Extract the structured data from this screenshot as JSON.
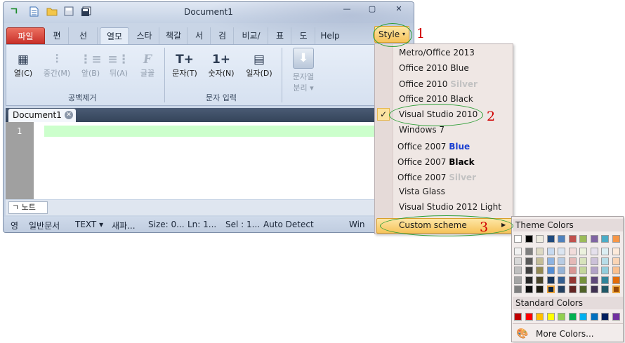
{
  "window": {
    "title": "Document1",
    "quick_access": [
      "ㄱ",
      "new-doc-icon",
      "open-folder-icon",
      "save-icon",
      "save-all-icon"
    ],
    "controls": [
      "—",
      "▢",
      "✕"
    ]
  },
  "tabs": [
    "파일",
    "편",
    "선",
    "열모",
    "스타",
    "책갈",
    "서",
    "검",
    "비교/",
    "표",
    "도",
    "Help"
  ],
  "ribbon": {
    "buttons": [
      {
        "label": "열(C)",
        "icon": "▦",
        "disabled": false
      },
      {
        "label": "중간(M)",
        "icon": "⫶",
        "disabled": true
      },
      {
        "label": "앞(B)",
        "icon": "⋮≡",
        "disabled": true
      },
      {
        "label": "뒤(A)",
        "icon": "≡⋮",
        "disabled": true
      },
      {
        "label": "글꼴",
        "icon": "F",
        "disabled": true
      },
      {
        "label": "문자(T)",
        "icon": "T+",
        "disabled": false
      },
      {
        "label": "숫자(N)",
        "icon": "1+",
        "disabled": false
      },
      {
        "label": "일자(D)",
        "icon": "▤",
        "disabled": false
      },
      {
        "label": "문자열",
        "label2": "분리 ▾",
        "icon": "⬇",
        "disabled": true
      }
    ],
    "groups": [
      "공백제거",
      "문자 입력"
    ]
  },
  "document": {
    "tab_label": "Document1",
    "line_number": "1"
  },
  "notes_tab": "ㄱ 노트",
  "status": {
    "mode": "영",
    "doc_type": "일반문서",
    "format": "TEXT ▾",
    "new": "새파...",
    "size": "Size: 0...",
    "line": "Ln: 1...",
    "sel": "Sel : 1...",
    "encoding": "Auto Detect",
    "eol": "Win"
  },
  "style_button": {
    "label": "Style",
    "arrow": "▾"
  },
  "style_menu": {
    "items": [
      {
        "text": "Metro/Office 2013"
      },
      {
        "text": "Office 2010 Blue"
      },
      {
        "text": "Office 2010 ",
        "bold": "Silver",
        "bold_class": "silver"
      },
      {
        "text": "Office 2010 Black"
      },
      {
        "text": "Visual Studio 2010",
        "checked": true
      },
      {
        "text": "Windows 7"
      },
      {
        "text": "Office 2007 ",
        "bold": "Blue",
        "bold_class": "blue"
      },
      {
        "text": "Office 2007 ",
        "bold": "Black",
        "bold_class": "black"
      },
      {
        "text": "Office 2007 ",
        "bold": "Silver",
        "bold_class": "silver"
      },
      {
        "text": "Vista Glass"
      },
      {
        "text": "Visual Studio 2012 Light"
      },
      {
        "text": "Custom scheme",
        "highlighted": true,
        "submenu": true
      }
    ],
    "check_glyph": "✓",
    "submenu_arrow": "▶"
  },
  "color_submenu": {
    "theme_header": "Theme Colors",
    "standard_header": "Standard Colors",
    "more_colors": "More Colors...",
    "theme_top": [
      "#ffffff",
      "#000000",
      "#eeece1",
      "#1f497d",
      "#4f81bd",
      "#c0504d",
      "#9bbb59",
      "#8064a2",
      "#4bacc6",
      "#f79646"
    ],
    "theme_shades": [
      [
        "#f2f2f2",
        "#7f7f7f",
        "#ddd9c3",
        "#c6d9f0",
        "#dbe5f1",
        "#f2dcdb",
        "#ebf1dd",
        "#e5e0ec",
        "#dbeef3",
        "#fdeada"
      ],
      [
        "#d8d8d8",
        "#595959",
        "#c4bd97",
        "#8db3e2",
        "#b8cce4",
        "#e5b9b7",
        "#d7e3bc",
        "#ccc1d9",
        "#b7dde8",
        "#fbd5b5"
      ],
      [
        "#bfbfbf",
        "#3f3f3f",
        "#938953",
        "#548dd4",
        "#95b3d7",
        "#d99694",
        "#c3d69b",
        "#b2a2c7",
        "#92cddc",
        "#fac08f"
      ],
      [
        "#a5a5a5",
        "#262626",
        "#494429",
        "#17365d",
        "#366092",
        "#953734",
        "#76923c",
        "#5f497a",
        "#31859b",
        "#e36c09"
      ],
      [
        "#7f7f7f",
        "#0c0c0c",
        "#1d1b10",
        "#0f243e",
        "#244061",
        "#632423",
        "#4f6128",
        "#3f3151",
        "#205867",
        "#974806"
      ]
    ],
    "standard": [
      "#c00000",
      "#ff0000",
      "#ffc000",
      "#ffff00",
      "#92d050",
      "#00b050",
      "#00b0f0",
      "#0070c0",
      "#002060",
      "#7030a0"
    ]
  },
  "annotations": [
    "1",
    "2",
    "3"
  ]
}
